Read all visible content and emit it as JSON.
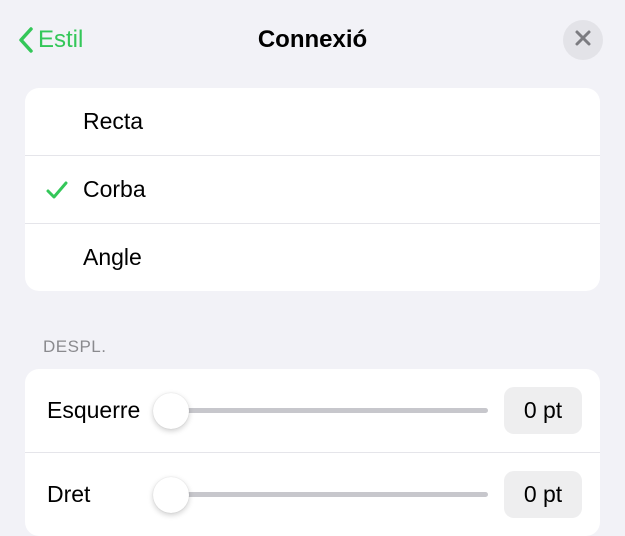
{
  "header": {
    "back_label": "Estil",
    "title": "Connexió"
  },
  "connection_types": {
    "items": [
      {
        "label": "Recta",
        "selected": false
      },
      {
        "label": "Corba",
        "selected": true
      },
      {
        "label": "Angle",
        "selected": false
      }
    ]
  },
  "offset": {
    "section_label": "Despl.",
    "left": {
      "label": "Esquerre",
      "value": "0 pt",
      "position": 0
    },
    "right": {
      "label": "Dret",
      "value": "0 pt",
      "position": 0
    }
  },
  "colors": {
    "accent": "#34c759"
  }
}
